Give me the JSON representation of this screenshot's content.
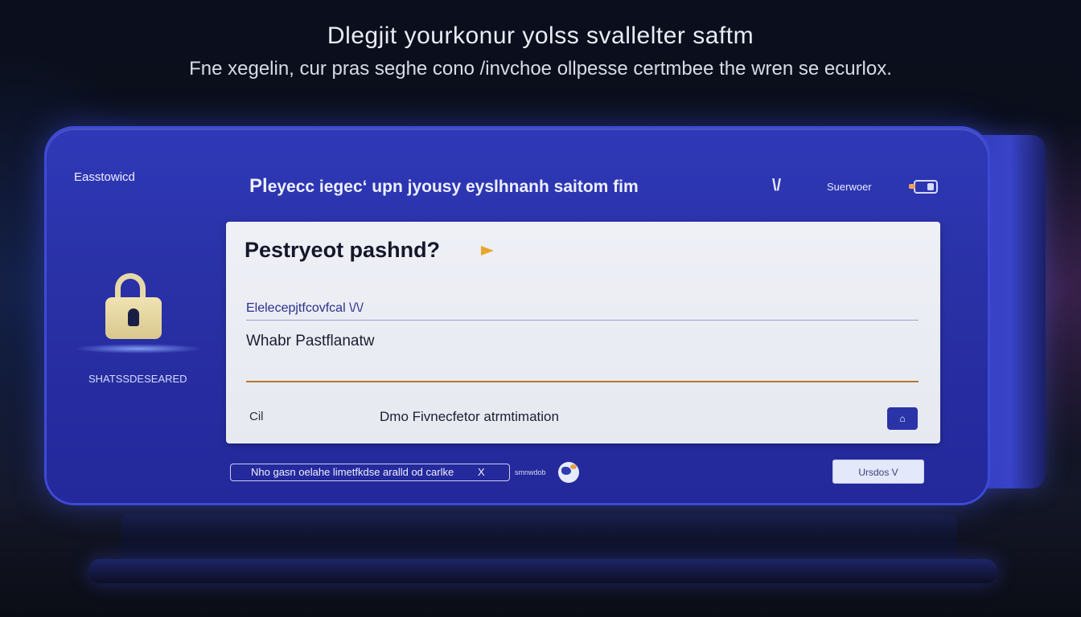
{
  "header": {
    "headline": "Dlegjit yourkonur yolss svallelter saftm",
    "subhead": "Fne xegelin, cur pras seghe cono /invchoe ollpesse certmbee the wren se ecurlox."
  },
  "sidebar": {
    "brand": "Easstowicd",
    "status": "SHATSSDESEARED"
  },
  "toolbar": {
    "prompt_first": "Pl",
    "prompt_rest": "eyecc iegecʻ upn jyousy eyslhnanh saitom fim",
    "icon_text": "\\/",
    "user_label": "Suerwoer"
  },
  "card": {
    "title": "Pestryeot pashnd?",
    "field_label": "Elelecepjtfcovfcal \\/\\/",
    "field_value": "Whabr Pastflanatw",
    "left_label": "Cil",
    "mid_label": "Dmo Fivnecfetor atrmtimation",
    "chat_button_glyph": "⌂"
  },
  "footer": {
    "remember_text": "Nho gasn oelahe limetfkdse aralld od carlke",
    "remember_toggle": "X",
    "small_label": "smnwdob",
    "login_label": "Ursdos V"
  },
  "colors": {
    "device": "#2a31a6",
    "card": "#eef0f6",
    "accent_underline": "#b37a2b",
    "arrow": "#e9a62a",
    "lock": "#e6d9a8"
  }
}
